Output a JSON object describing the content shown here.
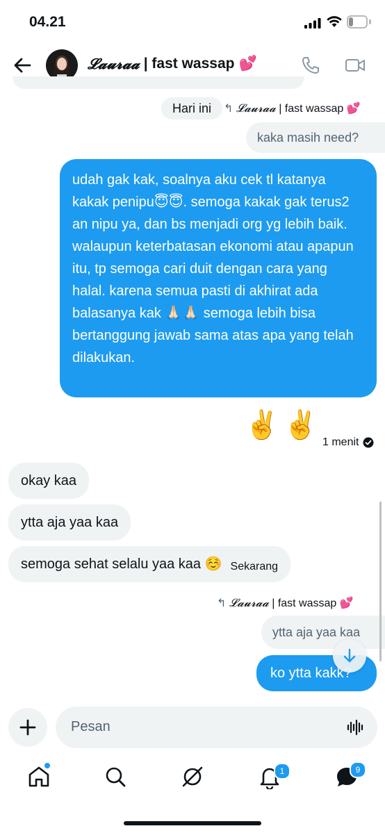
{
  "status_bar": {
    "time": "04.21",
    "battery": "5"
  },
  "header": {
    "name_script": "𝓛𝓪𝓾𝓻𝓪𝓪",
    "name_rest": "| fast wassap",
    "name_emoji": "💕"
  },
  "chat": {
    "date_label": "Hari ini",
    "reply1": {
      "script": "𝓛𝓪𝓾𝓻𝓪𝓪",
      "rest": "| fast wassap",
      "emoji": "💕",
      "quoted": "kaka masih need?"
    },
    "message_main": "udah gak kak, soalnya aku cek tl katanya kakak penipu😇😇. semoga kakak gak terus2 an nipu ya, dan bs menjadi org yg lebih baik. walaupun keterbatasan ekonomi atau apapun itu, tp semoga cari duit dengan cara yang halal. karena semua pasti di akhirat ada balasanya kak 🙏🏻🙏🏻 semoga lebih bisa bertanggung jawab sama atas apa yang telah dilakukan.",
    "emoji_message": "✌️✌️",
    "sent_time": "1 menit",
    "received": [
      {
        "text": "okay kaa"
      },
      {
        "text": "ytta aja yaa kaa"
      },
      {
        "text": "semoga sehat selalu yaa kaa ☺️",
        "time": "Sekarang"
      }
    ],
    "reply2": {
      "script": "𝓛𝓪𝓾𝓻𝓪𝓪",
      "rest": "| fast wassap",
      "emoji": "💕",
      "quoted": "ytta aja yaa kaa"
    },
    "last_message": "ko ytta kakk?"
  },
  "composer": {
    "placeholder": "Pesan"
  },
  "nav": {
    "notifications_badge": "1",
    "messages_badge": "9"
  },
  "colors": {
    "accent": "#1d9bf0",
    "bubble_in": "#eff3f4"
  }
}
